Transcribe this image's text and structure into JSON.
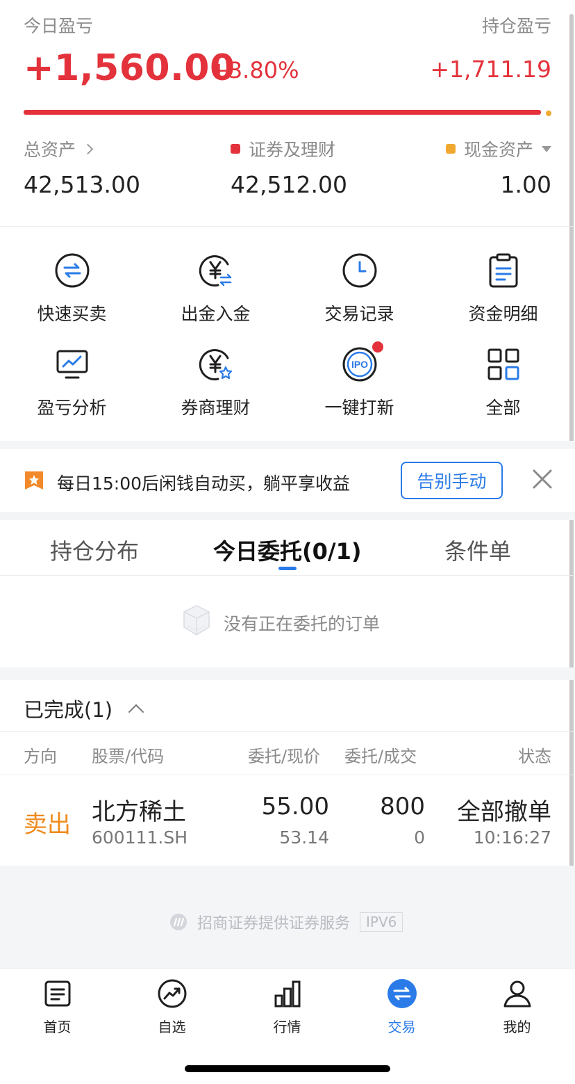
{
  "header": {
    "today_pl_label": "今日盈亏",
    "holding_pl_label": "持仓盈亏",
    "today_pl_value": "+1,560.00",
    "today_pl_pct": "+3.80%",
    "holding_pl_value": "+1,711.19",
    "ratio_bar_fraction": 0.98
  },
  "assets": {
    "total_label": "总资产",
    "total_value": "42,513.00",
    "securities_label": "证券及理财",
    "securities_value": "42,512.00",
    "cash_label": "现金资产",
    "cash_value": "1.00"
  },
  "quick_actions": [
    {
      "label": "快速买卖",
      "icon": "swap-icon"
    },
    {
      "label": "出金入金",
      "icon": "yuan-transfer-icon"
    },
    {
      "label": "交易记录",
      "icon": "clock-icon"
    },
    {
      "label": "资金明细",
      "icon": "clipboard-icon"
    },
    {
      "label": "盈亏分析",
      "icon": "monitor-chart-icon"
    },
    {
      "label": "券商理财",
      "icon": "yuan-star-icon"
    },
    {
      "label": "一键打新",
      "icon": "ipo-icon"
    },
    {
      "label": "全部",
      "icon": "grid-icon"
    }
  ],
  "promo": {
    "text": "每日15:00后闲钱自动买，躺平享收益",
    "button": "告别手动"
  },
  "tabs": [
    "持仓分布",
    "今日委托(0/1)",
    "条件单"
  ],
  "active_tab": 1,
  "empty_text": "没有正在委托的订单",
  "completed": {
    "title": "已完成(1)",
    "columns": [
      "方向",
      "股票/代码",
      "委托/现价",
      "委托/成交",
      "状态"
    ],
    "rows": [
      {
        "direction": "卖出",
        "stock_name": "北方稀土",
        "stock_code": "600111.SH",
        "order_price": "55.00",
        "current_price": "53.14",
        "order_qty": "800",
        "filled_qty": "0",
        "status": "全部撤单",
        "time": "10:16:27"
      }
    ]
  },
  "provider": {
    "text": "招商证券提供证券服务",
    "tag": "IPV6"
  },
  "nav": [
    {
      "label": "首页",
      "icon": "home-doc-icon"
    },
    {
      "label": "自选",
      "icon": "trend-circle-icon"
    },
    {
      "label": "行情",
      "icon": "bar-chart-icon"
    },
    {
      "label": "交易",
      "icon": "trade-swap-icon"
    },
    {
      "label": "我的",
      "icon": "user-icon"
    }
  ],
  "active_nav": 3,
  "colors": {
    "up_red": "#e3323b",
    "accent_blue": "#2a7be8",
    "cash_yellow": "#f0a830",
    "sell_orange": "#f08a1c"
  }
}
